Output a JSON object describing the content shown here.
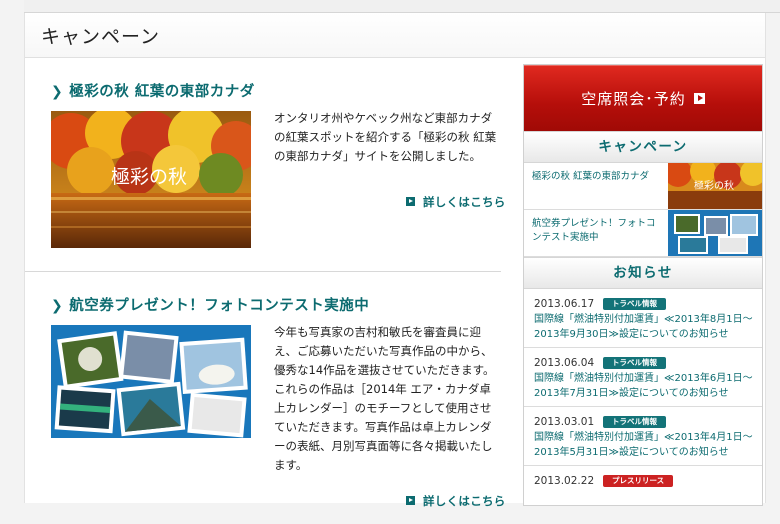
{
  "page_title": "キャンペーン",
  "articles": [
    {
      "title": "極彩の秋 紅葉の東部カナダ",
      "image_caption": "極彩の秋",
      "body": "オンタリオ州やケベック州など東部カナダの紅葉スポットを紹介する「極彩の秋 紅葉の東部カナダ」サイトを公開しました。",
      "more_label": "詳しくはこちら"
    },
    {
      "title": "航空券プレゼント！フォトコンテスト実施中",
      "body": "今年も写真家の吉村和敏氏を審査員に迎え、ご応募いただいた写真作品の中から、優秀な14作品を選抜させていただきます。これらの作品は［2014年 エア・カナダ卓上カレンダー］のモチーフとして使用させていただきます。写真作品は卓上カレンダーの表紙、月別写真面等に各々掲載いたします。",
      "more_label": "詳しくはこちら"
    }
  ],
  "sidebar": {
    "reserve_button": "空席照会･予約",
    "campaign_heading": "キャンペーン",
    "campaign_items": [
      {
        "text": "極彩の秋 紅葉の東部カナダ",
        "image_caption": "極彩の秋"
      },
      {
        "text": "航空券プレゼント！フォトコンテスト実施中"
      }
    ],
    "news_heading": "お知らせ",
    "news": [
      {
        "date": "2013.06.17",
        "badge": "トラベル情報",
        "text": "国際線「燃油特別付加運賃」≪2013年8月1日～2013年9月30日≫設定についてのお知らせ"
      },
      {
        "date": "2013.06.04",
        "badge": "トラベル情報",
        "text": "国際線「燃油特別付加運賃」≪2013年6月1日～2013年7月31日≫設定についてのお知らせ"
      },
      {
        "date": "2013.03.01",
        "badge": "トラベル情報",
        "text": "国際線「燃油特別付加運賃」≪2013年4月1日～2013年5月31日≫設定についてのお知らせ"
      },
      {
        "date": "2013.02.22",
        "badge": "プレスリリース",
        "text": ""
      }
    ]
  },
  "colors": {
    "accent": "#0c6b70",
    "reserve": "#c0120c",
    "badge_travel": "#137378",
    "badge_press": "#cc2222"
  }
}
